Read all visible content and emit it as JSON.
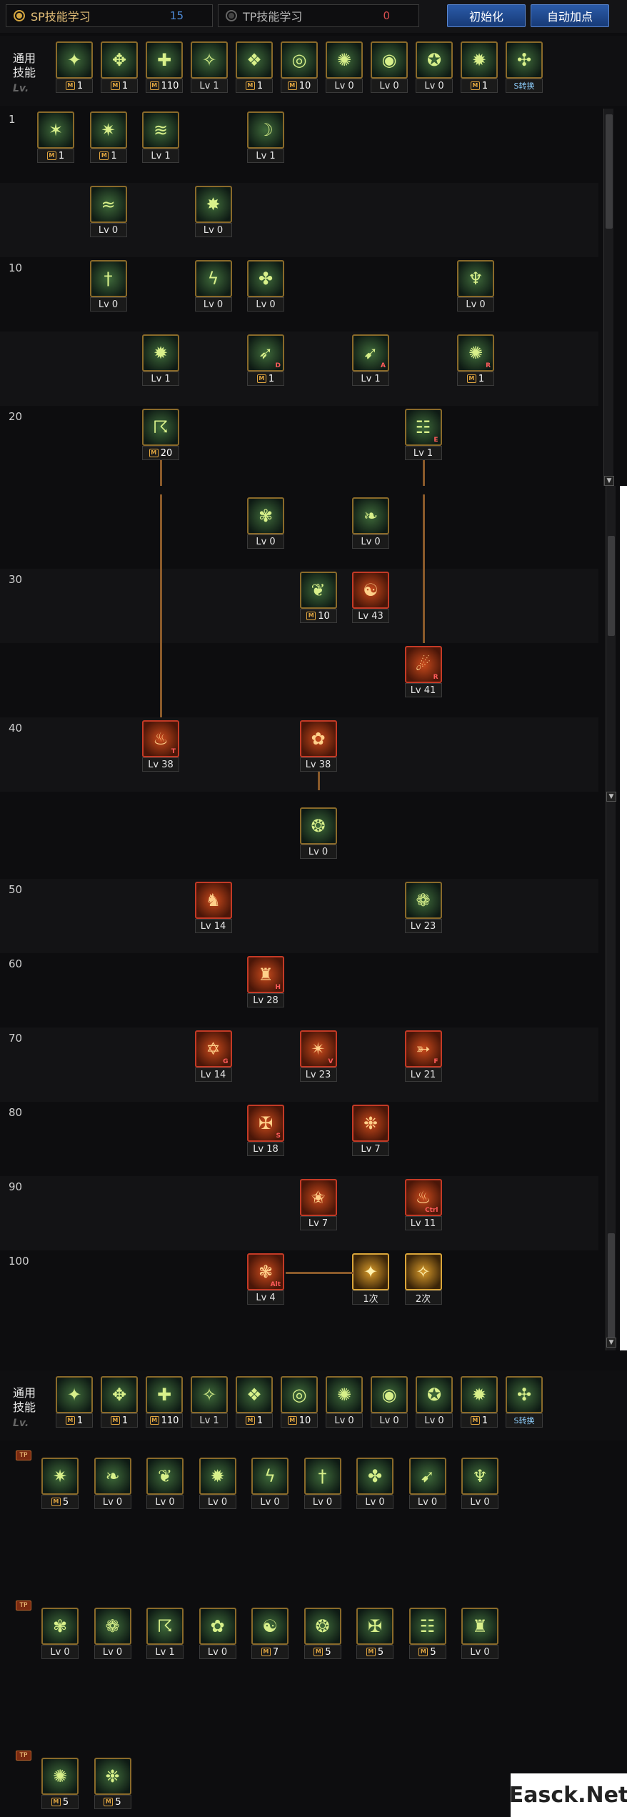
{
  "header": {
    "sp_tab_label": "SP技能学习",
    "sp_points": "15",
    "tp_tab_label": "TP技能学习",
    "tp_points": "0",
    "reset_button": "初始化",
    "auto_button": "自动加点"
  },
  "common_label": "通用技能",
  "lv_label": "Lv.",
  "common_skills": [
    {
      "icon": "✦",
      "kind": "m",
      "value": "1"
    },
    {
      "icon": "✥",
      "kind": "m",
      "value": "1"
    },
    {
      "icon": "✚",
      "kind": "m",
      "value": "110"
    },
    {
      "icon": "✧",
      "kind": "lv",
      "value": "Lv 1"
    },
    {
      "icon": "❖",
      "kind": "m",
      "value": "1"
    },
    {
      "icon": "◎",
      "kind": "m",
      "value": "10"
    },
    {
      "icon": "✺",
      "kind": "lv",
      "value": "Lv 0"
    },
    {
      "icon": "◉",
      "kind": "lv",
      "value": "Lv 0"
    },
    {
      "icon": "✪",
      "kind": "lv",
      "value": "Lv 0"
    },
    {
      "icon": "✹",
      "kind": "m",
      "value": "1"
    },
    {
      "icon": "✣",
      "kind": "text",
      "value": "S转换"
    }
  ],
  "level_labels": [
    "1",
    "10",
    "20",
    "30",
    "40",
    "50",
    "60",
    "70",
    "80",
    "90",
    "100"
  ],
  "tree1": [
    {
      "col": 0,
      "row": 0,
      "icon": "✶",
      "kind": "m",
      "value": "1"
    },
    {
      "col": 1,
      "row": 0,
      "icon": "✷",
      "kind": "m",
      "value": "1"
    },
    {
      "col": 2,
      "row": 0,
      "icon": "≋",
      "kind": "lv",
      "value": "Lv 1"
    },
    {
      "col": 4,
      "row": 0,
      "icon": "☽",
      "kind": "lv",
      "value": "Lv 1"
    },
    {
      "col": 1,
      "row": 1,
      "icon": "≈",
      "kind": "lv",
      "value": "Lv 0"
    },
    {
      "col": 3,
      "row": 1,
      "icon": "✸",
      "kind": "lv",
      "value": "Lv 0"
    },
    {
      "col": 1,
      "row": 2,
      "icon": "†",
      "kind": "lv",
      "value": "Lv 0"
    },
    {
      "col": 3,
      "row": 2,
      "icon": "ϟ",
      "kind": "lv",
      "value": "Lv 0"
    },
    {
      "col": 4,
      "row": 2,
      "icon": "✤",
      "kind": "lv",
      "value": "Lv 0"
    },
    {
      "col": 8,
      "row": 2,
      "icon": "♆",
      "kind": "lv",
      "value": "Lv 0"
    },
    {
      "col": 2,
      "row": 3,
      "icon": "✹",
      "kind": "lv",
      "value": "Lv 1"
    },
    {
      "col": 4,
      "row": 3,
      "icon": "➶",
      "kind": "m",
      "value": "1",
      "sub": "D"
    },
    {
      "col": 6,
      "row": 3,
      "icon": "➹",
      "kind": "lv",
      "value": "Lv 1",
      "sub": "A"
    },
    {
      "col": 8,
      "row": 3,
      "icon": "✺",
      "kind": "m",
      "value": "1",
      "sub": "R"
    },
    {
      "col": 2,
      "row": 4,
      "icon": "☈",
      "kind": "m",
      "value": "20"
    },
    {
      "col": 7,
      "row": 4,
      "icon": "☷",
      "kind": "lv",
      "value": "Lv 1",
      "sub": "E"
    }
  ],
  "tree2": [
    {
      "col": 4,
      "row": 0,
      "icon": "✾",
      "kind": "lv",
      "value": "Lv 0"
    },
    {
      "col": 6,
      "row": 0,
      "icon": "❧",
      "kind": "lv",
      "value": "Lv 0"
    },
    {
      "col": 5,
      "row": 1,
      "icon": "❦",
      "kind": "m",
      "value": "10"
    },
    {
      "col": 6,
      "row": 1,
      "icon": "☯",
      "kind": "lv",
      "value": "Lv 43",
      "red": true
    },
    {
      "col": 7,
      "row": 2,
      "icon": "☄",
      "kind": "lv",
      "value": "Lv 41",
      "red": true,
      "sub": "R"
    },
    {
      "col": 2,
      "row": 3,
      "icon": "♨",
      "kind": "lv",
      "value": "Lv 38",
      "red": true,
      "sub": "T"
    },
    {
      "col": 5,
      "row": 3,
      "icon": "✿",
      "kind": "lv",
      "value": "Lv 38",
      "red": true
    }
  ],
  "tree3": [
    {
      "col": 5,
      "row": 0,
      "icon": "❂",
      "kind": "lv",
      "value": "Lv 0"
    },
    {
      "col": 3,
      "row": 1,
      "icon": "♞",
      "kind": "lv",
      "value": "Lv 14",
      "red": true
    },
    {
      "col": 7,
      "row": 1,
      "icon": "❁",
      "kind": "lv",
      "value": "Lv 23"
    },
    {
      "col": 4,
      "row": 2,
      "icon": "♜",
      "kind": "lv",
      "value": "Lv 28",
      "red": true,
      "sub": "H"
    },
    {
      "col": 3,
      "row": 3,
      "icon": "✡",
      "kind": "lv",
      "value": "Lv 14",
      "red": true,
      "sub": "G"
    },
    {
      "col": 5,
      "row": 3,
      "icon": "✴",
      "kind": "lv",
      "value": "Lv 23",
      "red": true,
      "sub": "V"
    },
    {
      "col": 7,
      "row": 3,
      "icon": "➳",
      "kind": "lv",
      "value": "Lv 21",
      "red": true,
      "sub": "F"
    },
    {
      "col": 4,
      "row": 4,
      "icon": "✠",
      "kind": "lv",
      "value": "Lv 18",
      "red": true,
      "sub": "S"
    },
    {
      "col": 6,
      "row": 4,
      "icon": "❉",
      "kind": "lv",
      "value": "Lv 7",
      "red": true
    },
    {
      "col": 5,
      "row": 5,
      "icon": "✬",
      "kind": "lv",
      "value": "Lv 7",
      "red": true
    },
    {
      "col": 7,
      "row": 5,
      "icon": "♨",
      "kind": "lv",
      "value": "Lv 11",
      "red": true,
      "sub": "Ctrl"
    },
    {
      "col": 4,
      "row": 6,
      "icon": "❃",
      "kind": "lv",
      "value": "Lv 4",
      "red": true,
      "sub": "Alt"
    },
    {
      "col": 6,
      "row": 6,
      "icon": "✦",
      "kind": "lv",
      "value": "1次",
      "gold": true
    },
    {
      "col": 7,
      "row": 6,
      "icon": "✧",
      "kind": "lv",
      "value": "2次",
      "gold": true
    }
  ],
  "tp_rows": [
    {
      "mark": "TP",
      "skills": [
        {
          "icon": "✷",
          "kind": "m",
          "value": "5"
        },
        {
          "icon": "❧",
          "kind": "lv",
          "value": "Lv 0"
        },
        {
          "icon": "❦",
          "kind": "lv",
          "value": "Lv 0"
        },
        {
          "icon": "✹",
          "kind": "lv",
          "value": "Lv 0"
        },
        {
          "icon": "ϟ",
          "kind": "lv",
          "value": "Lv 0"
        },
        {
          "icon": "†",
          "kind": "lv",
          "value": "Lv 0"
        },
        {
          "icon": "✤",
          "kind": "lv",
          "value": "Lv 0"
        },
        {
          "icon": "➹",
          "kind": "lv",
          "value": "Lv 0"
        },
        {
          "icon": "♆",
          "kind": "lv",
          "value": "Lv 0"
        }
      ]
    },
    {
      "mark": "TP",
      "skills": [
        {
          "icon": "✾",
          "kind": "lv",
          "value": "Lv 0"
        },
        {
          "icon": "❁",
          "kind": "lv",
          "value": "Lv 0"
        },
        {
          "icon": "☈",
          "kind": "lv",
          "value": "Lv 1"
        },
        {
          "icon": "✿",
          "kind": "lv",
          "value": "Lv 0"
        },
        {
          "icon": "☯",
          "kind": "m",
          "value": "7"
        },
        {
          "icon": "❂",
          "kind": "m",
          "value": "5"
        },
        {
          "icon": "✠",
          "kind": "m",
          "value": "5"
        },
        {
          "icon": "☷",
          "kind": "m",
          "value": "5"
        },
        {
          "icon": "♜",
          "kind": "lv",
          "value": "Lv 0"
        }
      ]
    },
    {
      "mark": "TP",
      "skills": [
        {
          "icon": "✺",
          "kind": "m",
          "value": "5"
        },
        {
          "icon": "❉",
          "kind": "m",
          "value": "5"
        }
      ]
    }
  ],
  "watermark": "Easck.Net"
}
